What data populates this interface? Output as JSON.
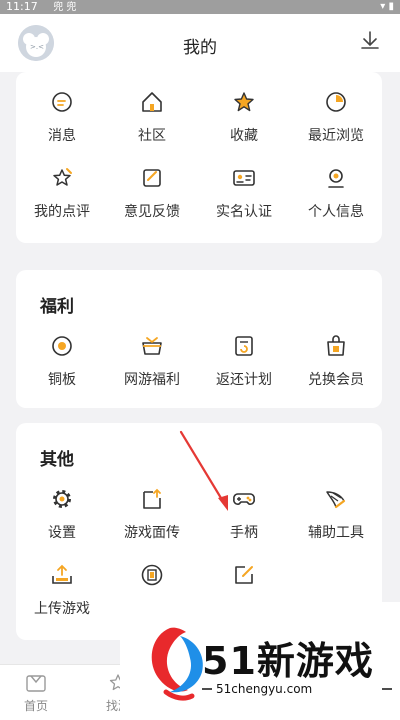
{
  "status_bar": {
    "time": "11:17",
    "indicators": "兜 兜"
  },
  "header": {
    "title": "我的"
  },
  "account_section": {
    "items": [
      {
        "label": "消息",
        "icon": "message-icon"
      },
      {
        "label": "社区",
        "icon": "home-icon"
      },
      {
        "label": "收藏",
        "icon": "star-icon"
      },
      {
        "label": "最近浏览",
        "icon": "history-icon"
      },
      {
        "label": "我的点评",
        "icon": "review-icon"
      },
      {
        "label": "意见反馈",
        "icon": "feedback-icon"
      },
      {
        "label": "实名认证",
        "icon": "id-card-icon"
      },
      {
        "label": "个人信息",
        "icon": "profile-icon"
      }
    ]
  },
  "welfare": {
    "title": "福利",
    "items": [
      {
        "label": "铜板",
        "icon": "coin-icon"
      },
      {
        "label": "网游福利",
        "icon": "gift-box-icon"
      },
      {
        "label": "返还计划",
        "icon": "refund-icon"
      },
      {
        "label": "兑换会员",
        "icon": "vip-bag-icon"
      }
    ]
  },
  "others": {
    "title": "其他",
    "items": [
      {
        "label": "设置",
        "icon": "gear-icon"
      },
      {
        "label": "游戏面传",
        "icon": "upload-file-icon"
      },
      {
        "label": "手柄",
        "icon": "gamepad-icon"
      },
      {
        "label": "辅助工具",
        "icon": "wing-icon"
      },
      {
        "label": "上传游戏",
        "icon": "upload-tray-icon"
      },
      {
        "label": "",
        "icon": "book-icon"
      },
      {
        "label": "",
        "icon": "edit-icon"
      }
    ]
  },
  "bottom_nav": {
    "items": [
      {
        "label": "首页",
        "icon": "home-nav-icon"
      },
      {
        "label": "找游",
        "icon": "find-star-icon"
      }
    ]
  },
  "watermark": {
    "brand": "51新游戏",
    "url": "51chengyu.com"
  },
  "colors": {
    "accent": "#f5a623",
    "icon_stroke": "#333333",
    "arrow": "#e53935",
    "logo_red": "#e8292c",
    "logo_blue": "#1f8fe8"
  }
}
